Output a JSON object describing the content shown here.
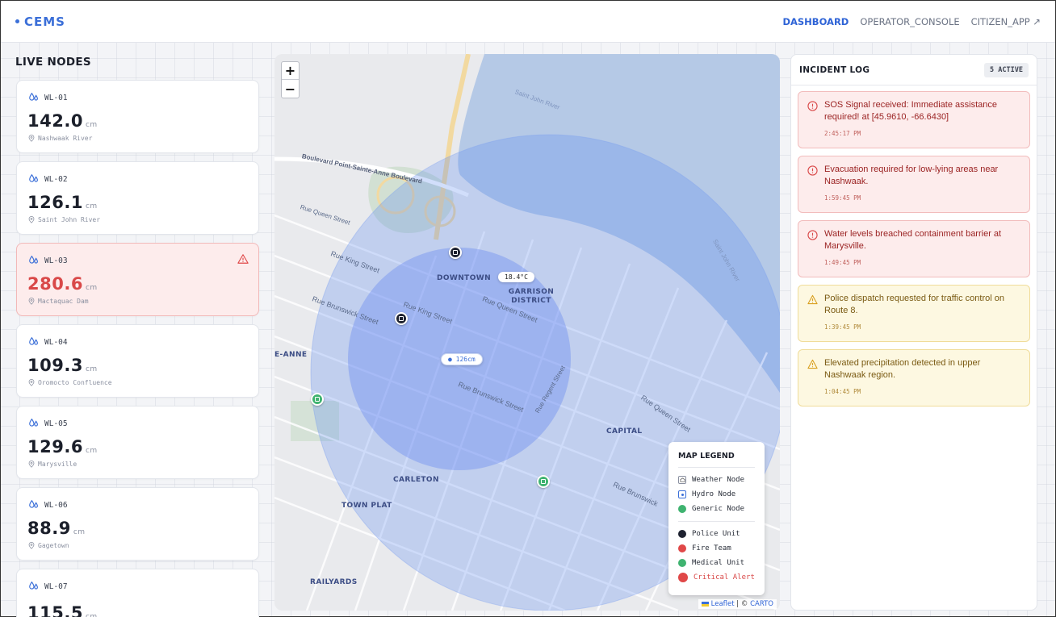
{
  "header": {
    "brand": "CEMS",
    "nav": [
      {
        "label": "DASHBOARD",
        "active": true
      },
      {
        "label": "OPERATOR_CONSOLE",
        "active": false
      },
      {
        "label": "CITIZEN_APP ↗",
        "active": false
      }
    ]
  },
  "live_nodes": {
    "title": "LIVE NODES",
    "unit": "cm",
    "nodes": [
      {
        "id": "WL-01",
        "value": "142.0",
        "location": "Nashwaak River",
        "alert": false
      },
      {
        "id": "WL-02",
        "value": "126.1",
        "location": "Saint John River",
        "alert": false
      },
      {
        "id": "WL-03",
        "value": "280.6",
        "location": "Mactaquac Dam",
        "alert": true
      },
      {
        "id": "WL-04",
        "value": "109.3",
        "location": "Oromocto Confluence",
        "alert": false
      },
      {
        "id": "WL-05",
        "value": "129.6",
        "location": "Marysville",
        "alert": false
      },
      {
        "id": "WL-06",
        "value": "88.9",
        "location": "Gagetown",
        "alert": false
      },
      {
        "id": "WL-07",
        "value": "115.5",
        "location": "",
        "alert": false
      }
    ]
  },
  "map": {
    "zoom_in": "+",
    "zoom_out": "−",
    "weather_reading": "18.4°C",
    "hydro_reading": "126cm",
    "districts": [
      "DOWNTOWN",
      "GARRISON DISTRICT",
      "CAPITAL",
      "CARLETON",
      "TOWN PLAT",
      "RAILYARDS",
      "E-ANNE"
    ],
    "streets": [
      "Saint John River",
      "Saint John River",
      "Boulevard Point-Sainte-Anne Boulevard",
      "Rue Queen Street",
      "Rue King Street",
      "Rue Brunswick Street",
      "Rue King Street",
      "Rue Queen Street",
      "Rue Brunswick Street",
      "Rue Regent Street",
      "Rue Queen Street",
      "Rue Brunswick"
    ],
    "attribution": {
      "leaflet": "Leaflet",
      "sep": " | © ",
      "carto": "CARTO"
    },
    "legend": {
      "title": "MAP LEGEND",
      "node_types": [
        {
          "label": "Weather Node",
          "icon": "weather-icon"
        },
        {
          "label": "Hydro Node",
          "icon": "hydro-icon"
        },
        {
          "label": "Generic Node",
          "color": "#3fb370"
        }
      ],
      "units": [
        {
          "label": "Police Unit",
          "color": "#1e2230"
        },
        {
          "label": "Fire Team",
          "color": "#e04848"
        },
        {
          "label": "Medical Unit",
          "color": "#3fb370"
        },
        {
          "label": "Critical Alert",
          "color": "#e04848"
        }
      ]
    }
  },
  "incident_log": {
    "title": "INCIDENT LOG",
    "badge": "5 ACTIVE",
    "incidents": [
      {
        "severity": "critical",
        "message": "SOS Signal received: Immediate assistance required! at [45.9610, -66.6430]",
        "time": "2:45:17 PM"
      },
      {
        "severity": "critical",
        "message": "Evacuation required for low-lying areas near Nashwaak.",
        "time": "1:59:45 PM"
      },
      {
        "severity": "critical",
        "message": "Water levels breached containment barrier at Marysville.",
        "time": "1:49:45 PM"
      },
      {
        "severity": "warning",
        "message": "Police dispatch requested for traffic control on Route 8.",
        "time": "1:39:45 PM"
      },
      {
        "severity": "warning",
        "message": "Elevated precipitation detected in upper Nashwaak region.",
        "time": "1:04:45 PM"
      }
    ]
  }
}
